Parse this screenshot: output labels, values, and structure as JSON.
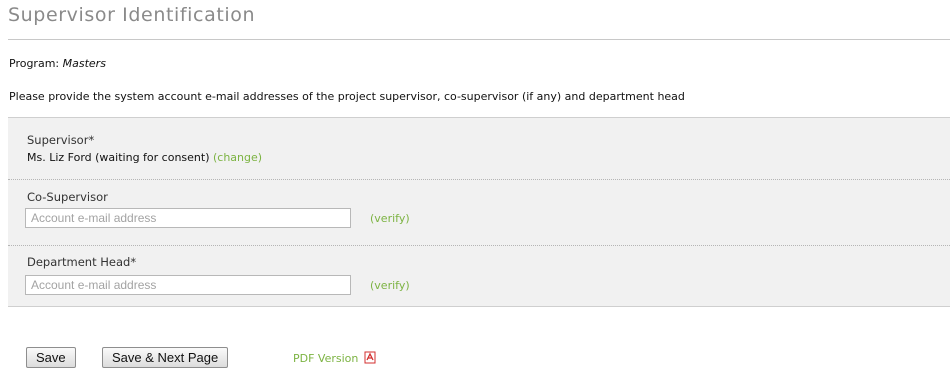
{
  "page": {
    "title": "Supervisor Identification",
    "program_label": "Program:",
    "program_value": "Masters",
    "instructions": "Please provide the system account e-mail addresses of the project supervisor, co-supervisor (if any) and department head"
  },
  "supervisor": {
    "label": "Supervisor*",
    "value": "Ms. Liz Ford (waiting for consent)",
    "change_label": "(change)"
  },
  "co_supervisor": {
    "label": "Co-Supervisor",
    "placeholder": "Account e-mail address",
    "verify_label": "(verify)"
  },
  "department_head": {
    "label": "Department Head*",
    "placeholder": "Account e-mail address",
    "verify_label": "(verify)"
  },
  "actions": {
    "save_label": "Save",
    "save_next_label": "Save & Next Page",
    "pdf_label": "PDF Version",
    "pdf_icon": "pdf-icon"
  },
  "colors": {
    "link_green": "#7cb342",
    "title_gray": "#8a8a8a",
    "panel_bg": "#f1f1f1",
    "pdf_red": "#d32f2f"
  }
}
